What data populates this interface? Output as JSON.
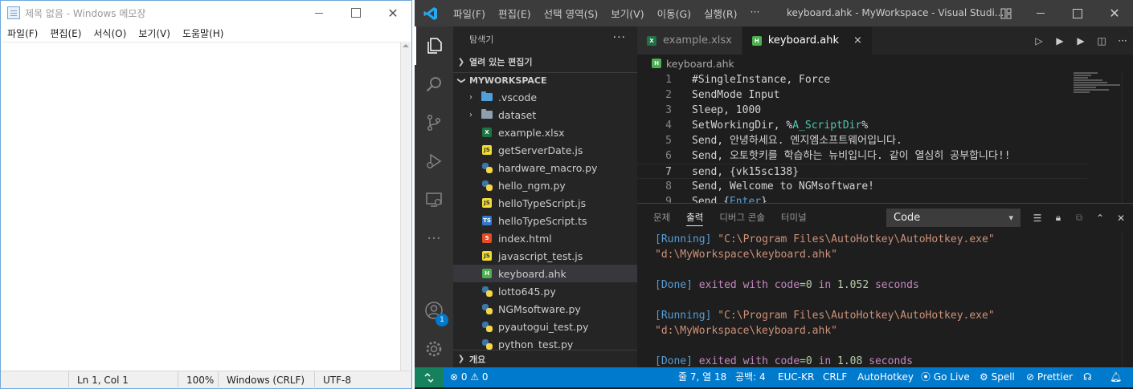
{
  "notepad": {
    "title": "제목 없음 - Windows 메모장",
    "menu": [
      "파일(F)",
      "편집(E)",
      "서식(O)",
      "보기(V)",
      "도움말(H)"
    ],
    "status": {
      "position": "Ln 1, Col 1",
      "zoom": "100%",
      "line_ending": "Windows (CRLF)",
      "encoding": "UTF-8"
    }
  },
  "vscode": {
    "menu": [
      "파일(F)",
      "편집(E)",
      "선택 영역(S)",
      "보기(V)",
      "이동(G)",
      "실행(R)",
      "···"
    ],
    "window_title": "keyboard.ahk - MyWorkspace - Visual Studi...",
    "account_badge": "1",
    "sidebar": {
      "header": "탐색기",
      "more": "···",
      "open_editors": "열려 있는 편집기",
      "workspace": "MYWORKSPACE",
      "outline": "개요",
      "items": [
        {
          "label": ".vscode",
          "type": "folder-vscode",
          "chevron": "›"
        },
        {
          "label": "dataset",
          "type": "folder",
          "chevron": "›"
        },
        {
          "label": "example.xlsx",
          "type": "xls",
          "icon_text": "X"
        },
        {
          "label": "getServerDate.js",
          "type": "js",
          "icon_text": "JS"
        },
        {
          "label": "hardware_macro.py",
          "type": "py"
        },
        {
          "label": "hello_ngm.py",
          "type": "py"
        },
        {
          "label": "helloTypeScript.js",
          "type": "js",
          "icon_text": "JS"
        },
        {
          "label": "helloTypeScript.ts",
          "type": "ts",
          "icon_text": "TS"
        },
        {
          "label": "index.html",
          "type": "html",
          "icon_text": "5"
        },
        {
          "label": "javascript_test.js",
          "type": "js",
          "icon_text": "JS"
        },
        {
          "label": "keyboard.ahk",
          "type": "ahk",
          "icon_text": "H"
        },
        {
          "label": "lotto645.py",
          "type": "py"
        },
        {
          "label": "NGMsoftware.py",
          "type": "py"
        },
        {
          "label": "pyautogui_test.py",
          "type": "py"
        },
        {
          "label": "python_test.py",
          "type": "py"
        }
      ]
    },
    "tabs": [
      {
        "label": "example.xlsx",
        "icon_text": "X"
      },
      {
        "label": "keyboard.ahk",
        "icon_text": "H",
        "close": "×"
      }
    ],
    "breadcrumb": {
      "label": "keyboard.ahk",
      "icon_text": "H"
    },
    "code_lines": [
      {
        "n": "1",
        "text": "#SingleInstance, Force"
      },
      {
        "n": "2",
        "text": "SendMode Input"
      },
      {
        "n": "3",
        "text": "Sleep, 1000"
      },
      {
        "n": "4",
        "pre": "SetWorkingDir, %",
        "var": "A_ScriptDir",
        "post": "%"
      },
      {
        "n": "5",
        "text": "Send, 안녕하세요. 엔지엠소프트웨어입니다."
      },
      {
        "n": "6",
        "text": "Send, 오토핫키를 학습하는 뉴비입니다. 같이 열심히 공부합니다!!"
      },
      {
        "n": "7",
        "text": "send, {vk15sc138}"
      },
      {
        "n": "8",
        "text": "Send, Welcome to NGMsoftware!"
      },
      {
        "n": "9",
        "pre": "Send {",
        "var": "Enter",
        "post": "}"
      }
    ],
    "current_line": "7",
    "panel": {
      "tabs": [
        "문제",
        "출력",
        "디버그 콘솔",
        "터미널"
      ],
      "active_tab": "출력",
      "channel": "Code",
      "output": [
        {
          "kind": "running",
          "tag": "[Running]",
          "str": "\"C:\\Program Files\\AutoHotkey\\AutoHotkey.exe\""
        },
        {
          "kind": "path",
          "str": "\"d:\\MyWorkspace\\keyboard.ahk\""
        },
        {
          "kind": "blank"
        },
        {
          "kind": "done",
          "tag": "[Done]",
          "w1": "exited",
          "w2": "with",
          "w3": "code",
          "eq": "=0",
          "w4": "in",
          "num": "1.052",
          "w5": "seconds"
        },
        {
          "kind": "blank"
        },
        {
          "kind": "running",
          "tag": "[Running]",
          "str": "\"C:\\Program Files\\AutoHotkey\\AutoHotkey.exe\""
        },
        {
          "kind": "path",
          "str": "\"d:\\MyWorkspace\\keyboard.ahk\""
        },
        {
          "kind": "blank"
        },
        {
          "kind": "done",
          "tag": "[Done]",
          "w1": "exited",
          "w2": "with",
          "w3": "code",
          "eq": "=0",
          "w4": "in",
          "num": "1.08",
          "w5": "seconds"
        }
      ]
    },
    "status": {
      "problems": "⊗ 0 ⚠ 0",
      "cursor": "줄 7, 열 18",
      "indent": "공백: 4",
      "encoding": "EUC-KR",
      "eol": "CRLF",
      "language": "AutoHotkey",
      "golive": "Go Live",
      "spell": "Spell",
      "prettier": "Prettier"
    },
    "colors": {
      "statusbar": "#007acc",
      "activity": "#333333",
      "sidebar": "#252526",
      "editor": "#1e1e1e"
    }
  }
}
